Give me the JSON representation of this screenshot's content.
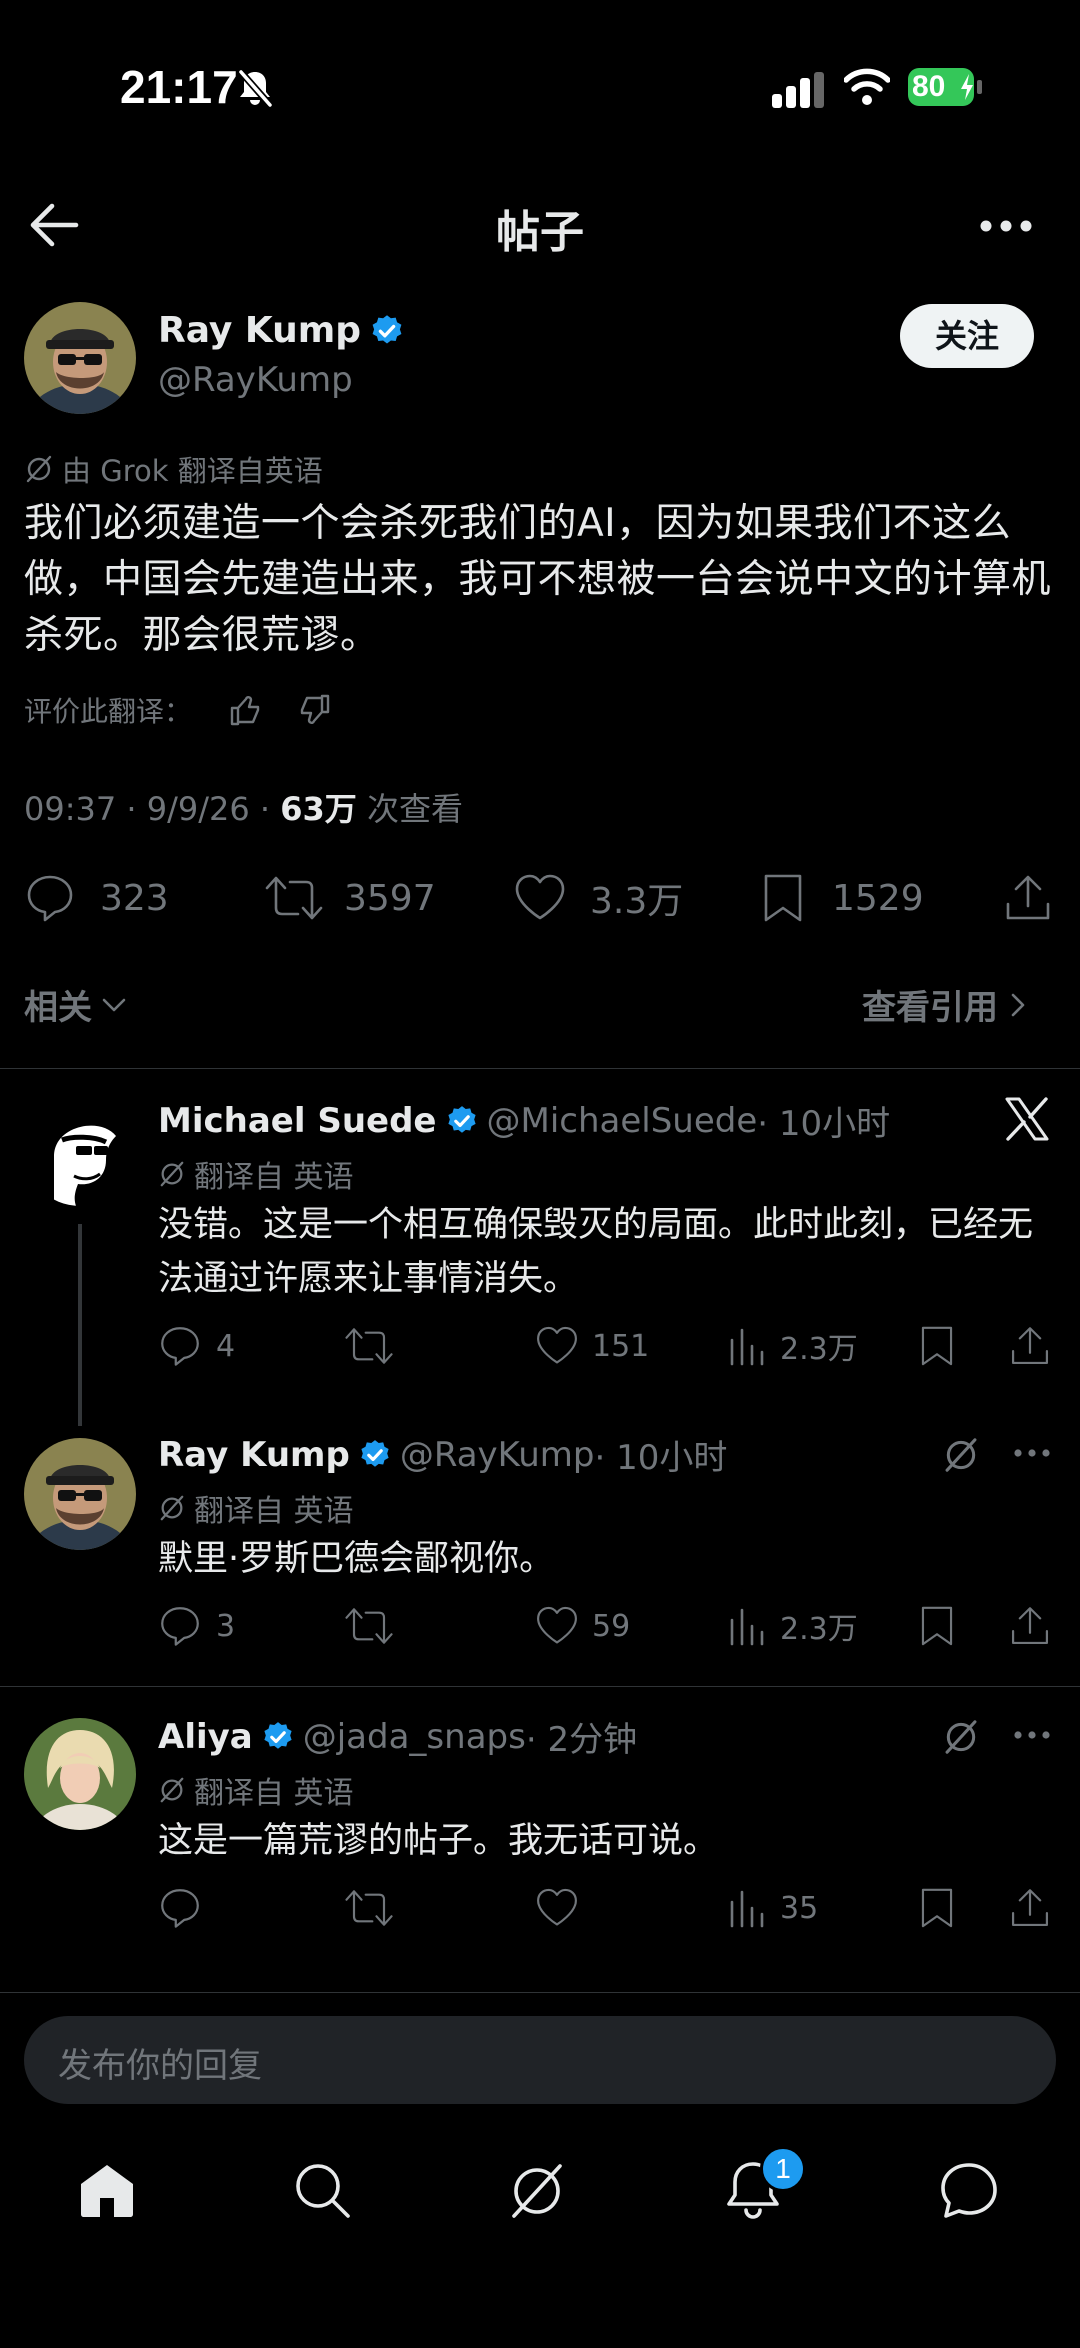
{
  "status_bar": {
    "time": "21:17",
    "battery": "80"
  },
  "header": {
    "title": "帖子"
  },
  "post": {
    "display_name": "Ray Kump",
    "handle": "@RayKump",
    "follow_label": "关注",
    "translation_note": "由 Grok 翻译自英语",
    "text": "我们必须建造一个会杀死我们的AI，因为如果我们不这么做，中国会先建造出来，我可不想被一台会说中文的计算机杀死。那会很荒谬。",
    "rate_label": "评价此翻译：",
    "timestamp": "09:37 · 9/9/26 · ",
    "views_count": "63万",
    "views_label": " 次查看",
    "replies": "323",
    "reposts": "3597",
    "likes": "3.3万",
    "bookmarks": "1529"
  },
  "sort": {
    "label": "相关",
    "quotes_label": "查看引用"
  },
  "replies": [
    {
      "display_name": "Michael Suede",
      "handle": "@MichaelSuede",
      "time": " · 10小时",
      "translation_note": "翻译自 英语",
      "text": "没错。这是一个相互确保毁灭的局面。此时此刻，已经无法通过许愿来让事情消失。",
      "replies": "4",
      "reposts": "",
      "likes": "151",
      "views": "2.3万"
    },
    {
      "display_name": "Ray Kump",
      "handle": "@RayKump",
      "time": " · 10小时",
      "translation_note": "翻译自 英语",
      "text": "默里·罗斯巴德会鄙视你。",
      "replies": "3",
      "reposts": "",
      "likes": "59",
      "views": "2.3万"
    },
    {
      "display_name": "Aliya",
      "handle": "@jada_snaps",
      "time": " · 2分钟",
      "translation_note": "翻译自 英语",
      "text": "这是一篇荒谬的帖子。我无话可说。",
      "replies": "",
      "reposts": "",
      "likes": "",
      "views": "35"
    }
  ],
  "compose": {
    "placeholder": "发布你的回复"
  },
  "bottom_nav": {
    "notifications_badge": "1"
  },
  "colors": {
    "verified": "#1d9bf0",
    "battery": "#34c759",
    "background": "#000000"
  }
}
